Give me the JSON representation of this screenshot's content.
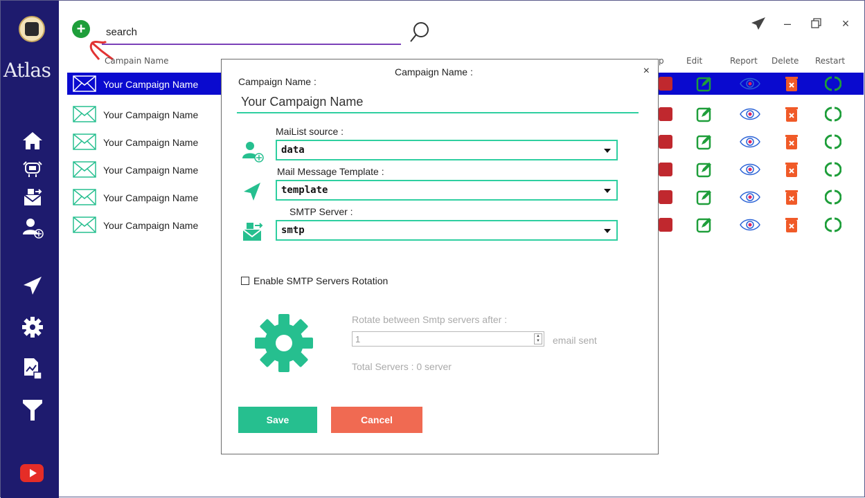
{
  "app": {
    "brand": "Atlas"
  },
  "search": {
    "placeholder": "search",
    "value": "search"
  },
  "table": {
    "headers": {
      "name": "Campain Name",
      "p": "p",
      "edit": "Edit",
      "report": "Report",
      "delete": "Delete",
      "restart": "Restart"
    },
    "rows": [
      {
        "name": "Your Campaign Name",
        "selected": true
      },
      {
        "name": "Your Campaign Name",
        "selected": false
      },
      {
        "name": "Your Campaign Name",
        "selected": false
      },
      {
        "name": "Your Campaign Name",
        "selected": false
      },
      {
        "name": "Your Campaign Name",
        "selected": false
      },
      {
        "name": "Your Campaign Name",
        "selected": false
      }
    ]
  },
  "modal": {
    "title": "Campaign Name :",
    "close": "×",
    "name_label": "Campaign Name :",
    "name_value": "Your Campaign Name",
    "mailist_label": "MaiList source :",
    "mailist_value": "data",
    "template_label": "Mail Message Template :",
    "template_value": "template",
    "smtp_label": "SMTP Server :",
    "smtp_value": "smtp",
    "rotation_label": "Enable SMTP Servers Rotation",
    "rotation_checked": false,
    "rotate_label": "Rotate between Smtp servers after :",
    "rotate_value": "1",
    "email_sent": "email sent",
    "total_servers": "Total Servers : 0 server",
    "save": "Save",
    "cancel": "Cancel"
  },
  "colors": {
    "sidebar": "#1e1b6e",
    "accent": "#26bf8f",
    "selected_row": "#0a0acf",
    "cancel": "#f06a52"
  }
}
